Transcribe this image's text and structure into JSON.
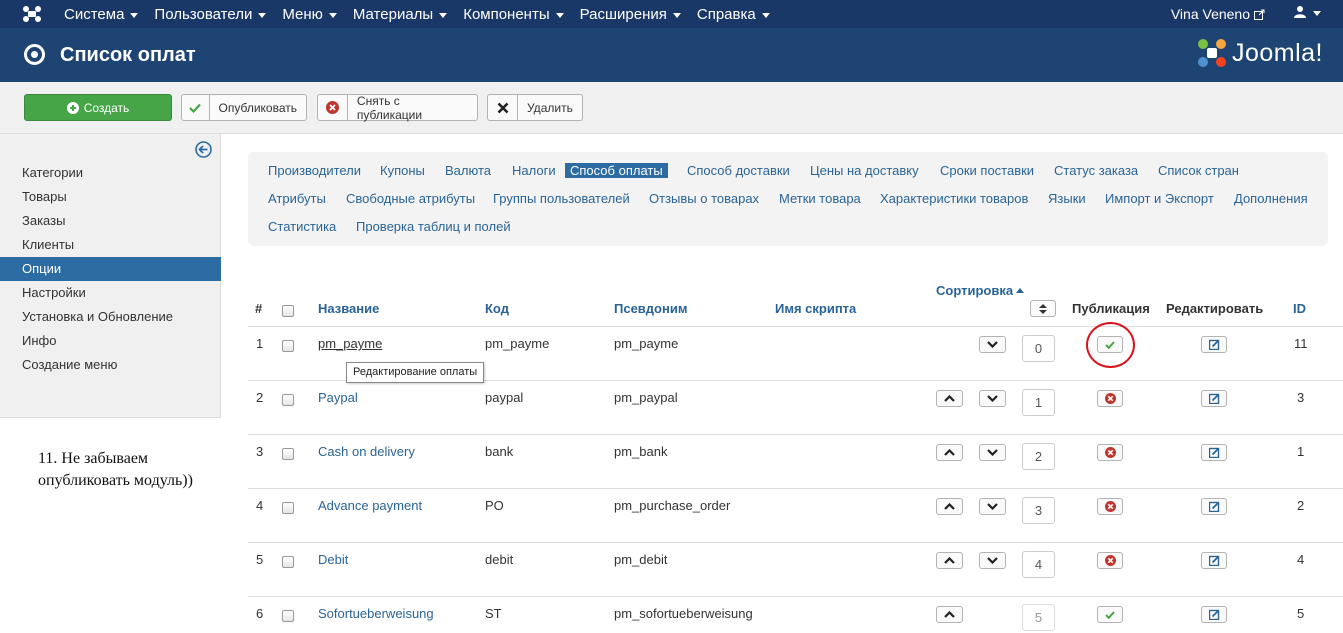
{
  "topnav": {
    "menu": [
      {
        "label": "Система"
      },
      {
        "label": "Пользователи"
      },
      {
        "label": "Меню"
      },
      {
        "label": "Материалы"
      },
      {
        "label": "Компоненты"
      },
      {
        "label": "Расширения"
      },
      {
        "label": "Справка"
      }
    ],
    "user_label": "Vina Veneno"
  },
  "header": {
    "title": "Список оплат",
    "brand": "Joomla!"
  },
  "toolbar": {
    "create": "Создать",
    "publish": "Опубликовать",
    "unpublish": "Снять с публикации",
    "delete": "Удалить"
  },
  "sidebar": {
    "items": [
      {
        "label": "Категории"
      },
      {
        "label": "Товары"
      },
      {
        "label": "Заказы"
      },
      {
        "label": "Клиенты"
      },
      {
        "label": "Опции",
        "active": true
      },
      {
        "label": "Настройки"
      },
      {
        "label": "Установка и Обновление"
      },
      {
        "label": "Инфо"
      },
      {
        "label": "Создание меню"
      }
    ]
  },
  "note": "11. Не забываем опубликовать модуль))",
  "submenu": {
    "row1": [
      "Производители",
      "Купоны",
      "Валюта",
      "Налоги",
      "Способ оплаты",
      "Способ доставки",
      "Цены на доставку",
      "Сроки поставки",
      "Статус заказа",
      "Список стран"
    ],
    "row2": [
      "Атрибуты",
      "Свободные атрибуты",
      "Группы пользователей",
      "Отзывы о товарах",
      "Метки товара",
      "Характеристики товаров",
      "Языки",
      "Импорт и Экспорт",
      "Дополнения"
    ],
    "row3": [
      "Статистика",
      "Проверка таблиц и полей"
    ],
    "active": "Способ оплаты"
  },
  "table": {
    "headers": {
      "num": "#",
      "name": "Название",
      "code": "Код",
      "alias": "Псевдоним",
      "script": "Имя скрипта",
      "sort": "Сортировка",
      "publish": "Публикация",
      "edit": "Редактировать",
      "id": "ID"
    },
    "rows": [
      {
        "num": "1",
        "name": "pm_payme",
        "code": "pm_payme",
        "alias": "pm_payme",
        "script": "",
        "order": "0",
        "published": true,
        "id": "11"
      },
      {
        "num": "2",
        "name": "Paypal",
        "code": "paypal",
        "alias": "pm_paypal",
        "script": "",
        "order": "1",
        "published": false,
        "id": "3"
      },
      {
        "num": "3",
        "name": "Cash on delivery",
        "code": "bank",
        "alias": "pm_bank",
        "script": "",
        "order": "2",
        "published": false,
        "id": "1"
      },
      {
        "num": "4",
        "name": "Advance payment",
        "code": "PO",
        "alias": "pm_purchase_order",
        "script": "",
        "order": "3",
        "published": false,
        "id": "2"
      },
      {
        "num": "5",
        "name": "Debit",
        "code": "debit",
        "alias": "pm_debit",
        "script": "",
        "order": "4",
        "published": false,
        "id": "4"
      },
      {
        "num": "6",
        "name": "Sofortueberweisung",
        "code": "ST",
        "alias": "pm_sofortueberweisung",
        "script": "",
        "order": "5",
        "published": true,
        "id": "5"
      }
    ]
  },
  "tooltip": "Редактирование оплаты",
  "colors": {
    "navbar": "#1a3867",
    "titlebar": "#1d4473",
    "accent": "#2d6ca2",
    "link": "#2a6496",
    "create_green": "#46a546",
    "publish_green": "#46a546",
    "unpublish_red": "#bd362f",
    "highlight_circle": "#d9121b"
  }
}
